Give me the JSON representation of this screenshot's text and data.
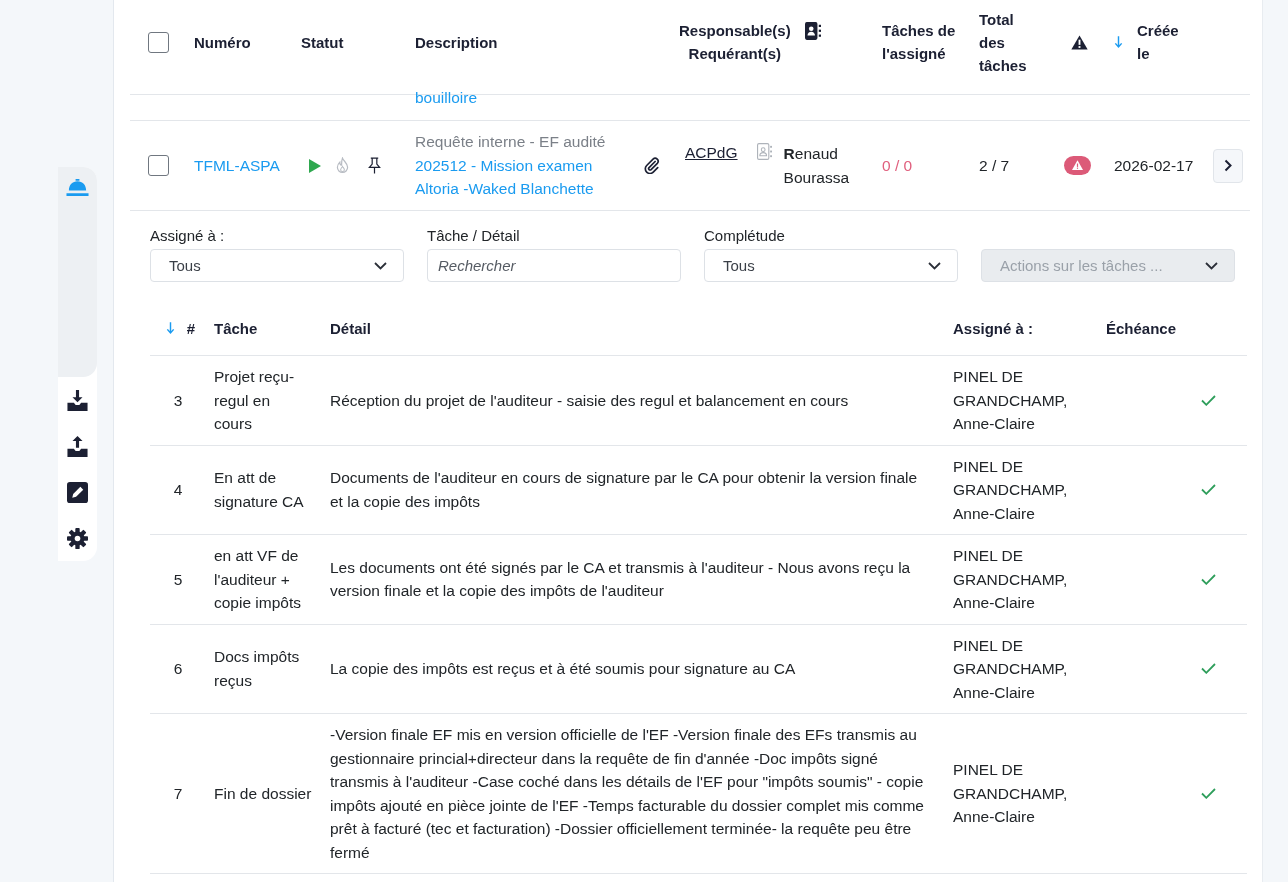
{
  "sidebar": {
    "items": [
      {
        "selected": true
      },
      {
        "selected": false
      },
      {
        "selected": false
      },
      {
        "selected": false
      },
      {
        "selected": false
      }
    ]
  },
  "requests_table": {
    "select_all": {
      "checked": false
    },
    "columns": [
      {
        "kind": "text",
        "label": "Numéro",
        "sorted": false
      },
      {
        "kind": "text",
        "label": "Statut",
        "sorted": false
      },
      {
        "kind": "text",
        "label": "Description",
        "sorted": false
      },
      {
        "kind": "people",
        "label": "Responsable(s)",
        "sublabel": "Requérant(s)",
        "sorted": false
      },
      {
        "kind": "text",
        "label": "Tâches de l'assigné",
        "sorted": false
      },
      {
        "kind": "text",
        "label": "Total des tâches",
        "sorted": false
      },
      {
        "kind": "alert",
        "sorted": false
      },
      {
        "kind": "text",
        "label": "Créée le",
        "sorted": true
      }
    ],
    "rows": [
      {
        "kind": "partial",
        "description_link": "bouilloire"
      },
      {
        "kind": "full",
        "checked": false,
        "number": "TFML-ASPA",
        "description_type": "Requête interne - EF audité",
        "description_link": "202512 - Mission examen Altoria -Waked Blanchette",
        "responsible": "ACPdG",
        "requester": "**R**enaud Bourassa",
        "assignee_tasks": "0 / 0",
        "total_tasks": "2 / 7",
        "alert": true,
        "created": "2026-02-17"
      }
    ]
  },
  "task_panel": {
    "filters": [
      {
        "kind": "select",
        "label": "Assigné à :",
        "value": "Tous",
        "disabled": false
      },
      {
        "kind": "search",
        "label": "Tâche / Détail",
        "placeholder": "Rechercher",
        "disabled": false
      },
      {
        "kind": "select",
        "label": "Complétude",
        "value": "Tous",
        "disabled": false
      },
      {
        "kind": "select",
        "value": "Actions sur les tâches ...",
        "disabled": true
      }
    ],
    "columns": [
      {
        "label": "#",
        "sorted": true
      },
      {
        "label": "Tâche",
        "sorted": false
      },
      {
        "label": "Détail",
        "sorted": false
      },
      {
        "label": "Assigné à :",
        "sorted": false
      },
      {
        "label": "Échéance",
        "sorted": false
      }
    ],
    "tasks": [
      {
        "number": "3",
        "task": "Projet reçu-regul en cours",
        "detail": "Réception du projet de l'auditeur - saisie des regul et balancement en cours",
        "assignee": "PINEL DE GRANDCHAMP, Anne-Claire",
        "completed": true
      },
      {
        "number": "4",
        "task": "En att de signature CA",
        "detail": "Documents de l'auditeur en cours de signature par le CA pour obtenir la version finale et la copie des impôts",
        "assignee": "PINEL DE GRANDCHAMP, Anne-Claire",
        "completed": true
      },
      {
        "number": "5",
        "task": "en att VF de l'auditeur + copie impôts",
        "detail": "Les documents ont été signés par le CA et transmis à l'auditeur - Nous avons reçu la version finale et la copie des impôts de l'auditeur",
        "assignee": "PINEL DE GRANDCHAMP, Anne-Claire",
        "completed": true
      },
      {
        "number": "6",
        "task": "Docs impôts reçus",
        "detail": "La copie des impôts est reçus et à été soumis pour signature au CA",
        "assignee": "PINEL DE GRANDCHAMP, Anne-Claire",
        "completed": true
      },
      {
        "number": "7",
        "task": "Fin de dossier",
        "detail": "-Version finale EF mis en version officielle de l'EF -Version finale des EFs transmis au gestionnaire princial+directeur dans la requête de fin d'année -Doc impôts signé transmis à l'auditeur -Case coché dans les détails de l'EF pour \"impôts soumis\" - copie impôts ajouté en pièce jointe de l'EF -Temps facturable du dossier complet mis comme prêt à facturé (tec et facturation) -Dossier officiellement terminée- la requête peu être fermé",
        "assignee": "PINEL DE GRANDCHAMP, Anne-Claire",
        "completed": true
      }
    ]
  }
}
